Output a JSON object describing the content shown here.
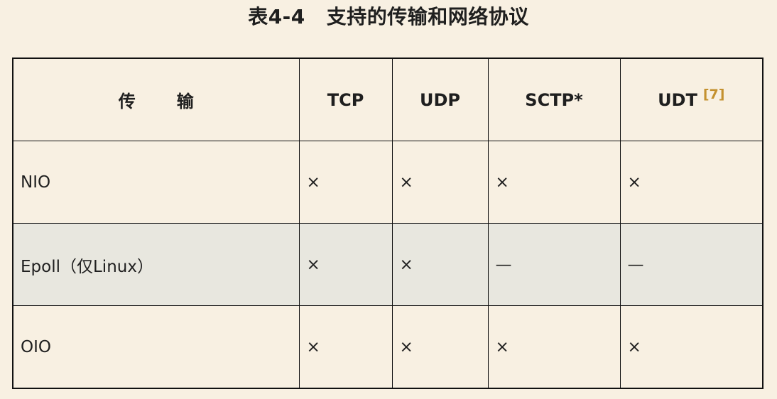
{
  "caption": {
    "number": "表4-4",
    "title": "支持的传输和网络协议"
  },
  "table": {
    "headers": [
      "传输",
      "TCP",
      "UDP",
      "SCTP*",
      "UDT"
    ],
    "udt_reference": "[7]",
    "rows": [
      {
        "transport": "NIO",
        "tcp": "×",
        "udp": "×",
        "sctp": "×",
        "udt": "×"
      },
      {
        "transport": "Epoll（仅Linux）",
        "tcp": "×",
        "udp": "×",
        "sctp": "—",
        "udt": "—"
      },
      {
        "transport": "OIO",
        "tcp": "×",
        "udp": "×",
        "sctp": "×",
        "udt": "×"
      }
    ]
  },
  "colors": {
    "background": "#f8f0e2",
    "shaded_row": "#e8e7df",
    "reference_link": "#c4912f",
    "border": "#111111"
  }
}
